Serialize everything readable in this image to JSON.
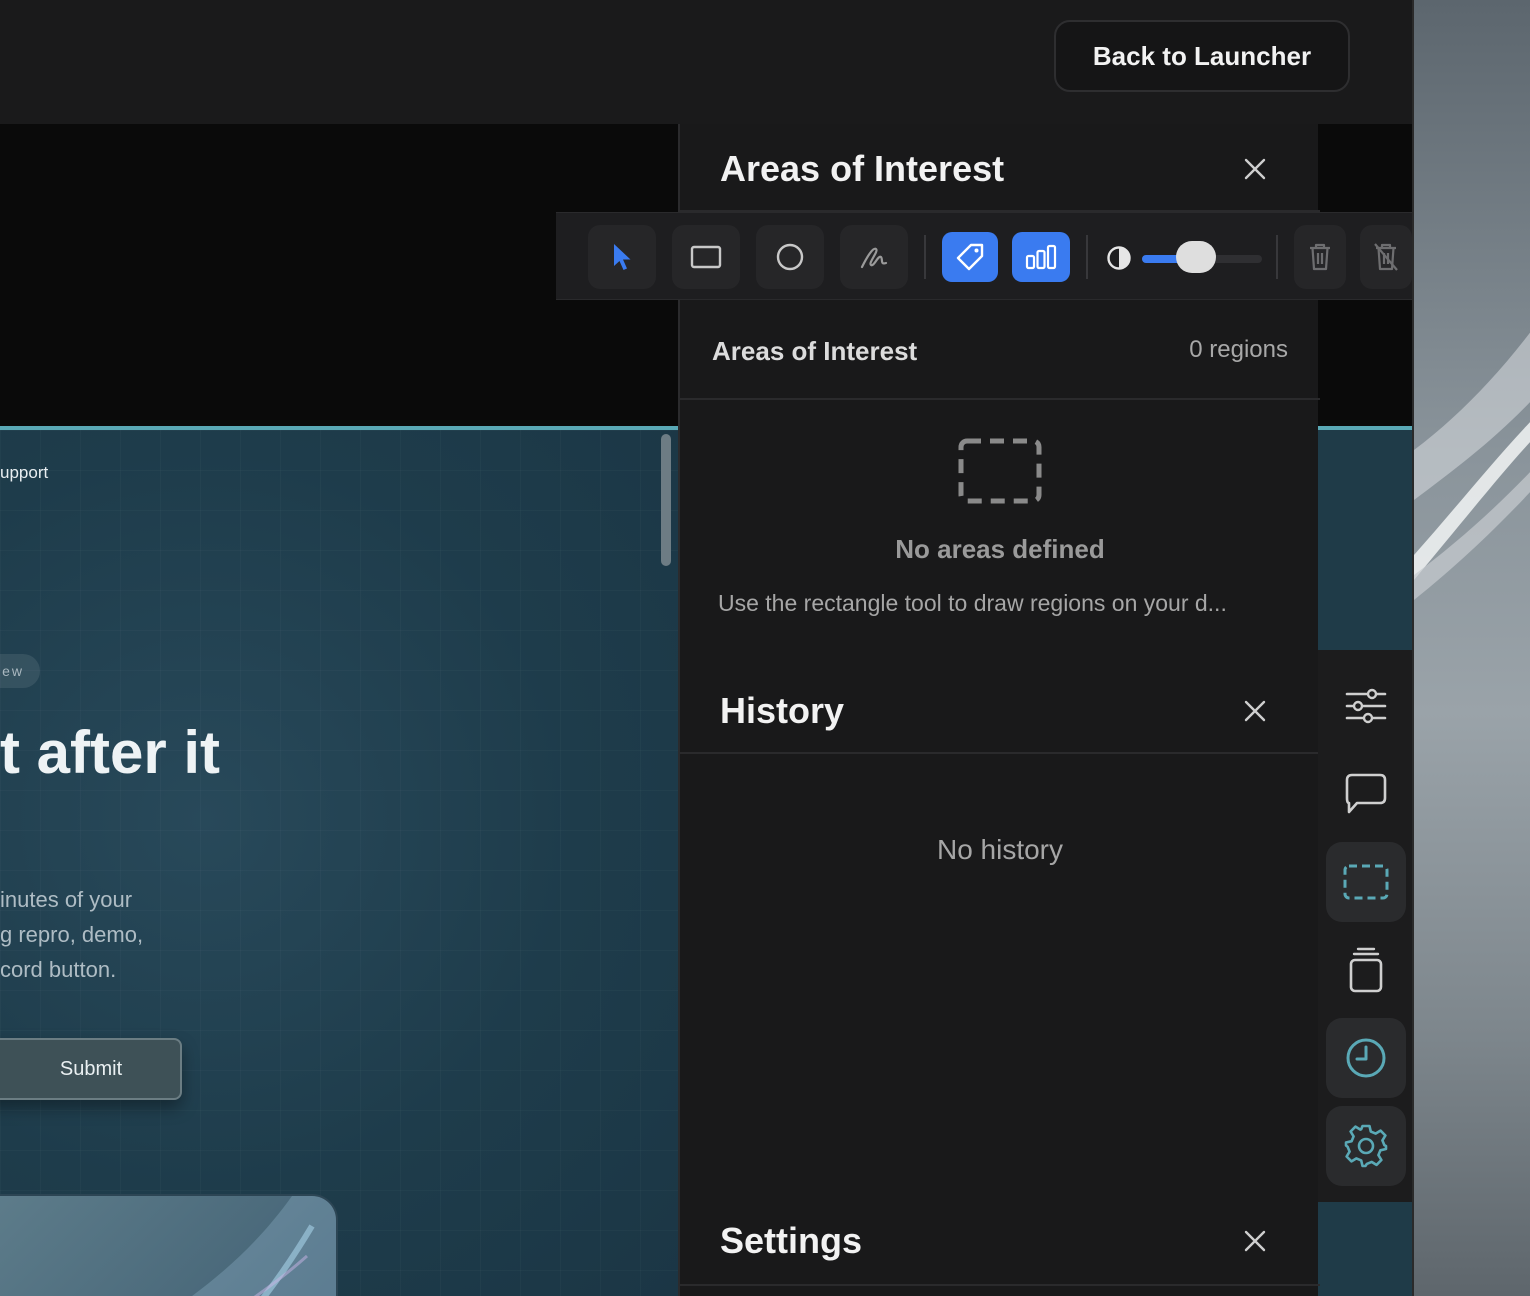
{
  "header": {
    "back_button": "Back to Launcher"
  },
  "toolbar": {
    "tools": [
      "select-tool",
      "rectangle-tool",
      "ellipse-tool",
      "freehand-tool",
      "tag-tool",
      "chart-tool"
    ],
    "opacity_level": 0.45,
    "accent_color": "#3a7bf0"
  },
  "panels": {
    "areas": {
      "title": "Areas of Interest",
      "subheader": "Areas of Interest",
      "count": "0 regions",
      "empty_title": "No areas defined",
      "empty_desc": "Use the rectangle tool to draw regions on your d..."
    },
    "history": {
      "title": "History",
      "empty": "No history"
    },
    "settings": {
      "title": "Settings"
    }
  },
  "site": {
    "nav_fragment": "upport",
    "pill_fragment": "ew",
    "headline_fragment": "t after it",
    "paragraph_lines": [
      "inutes of your",
      "g repro, demo,",
      "cord button."
    ],
    "submit_label": "Submit"
  },
  "dock": {
    "items": [
      "sliders-icon",
      "comment-icon",
      "area-select-icon",
      "stack-icon",
      "clock-icon",
      "gear-icon"
    ],
    "active_color": "#5aa9b6"
  }
}
